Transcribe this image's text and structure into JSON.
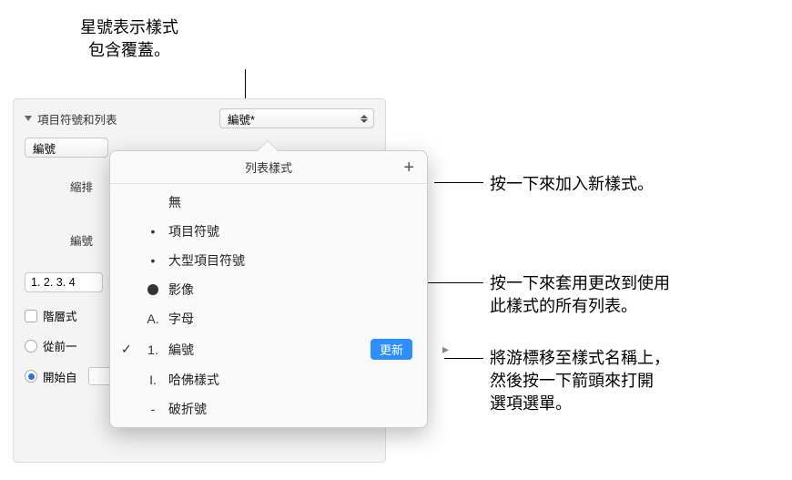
{
  "callouts": {
    "asterisk": "星號表示樣式\n包含覆蓋。",
    "add": "按一下來加入新樣式。",
    "update": "按一下來套用更改到使用\n此樣式的所有列表。",
    "arrow": "將游標移至樣式名稱上，\n然後按一下箭頭來打開\n選項選單。"
  },
  "panel": {
    "section_title": "項目符號和列表",
    "style_select_value": "編號*",
    "sub_select_value": "編號",
    "indent_label": "縮排",
    "numbering_label": "編號",
    "num_style_value": "1. 2. 3. 4",
    "hierarchical_label": "階層式",
    "continue_label": "從前一",
    "start_from_label": "開始自"
  },
  "popover": {
    "title": "列表樣式",
    "items": [
      {
        "bullet": "",
        "label": "無"
      },
      {
        "bullet": "•",
        "label": "項目符號"
      },
      {
        "bullet": "•",
        "label": "大型項目符號"
      },
      {
        "bullet": "IMG",
        "label": "影像"
      },
      {
        "bullet": "A.",
        "label": "字母"
      },
      {
        "bullet": "1.",
        "label": "編號",
        "selected": true,
        "update_label": "更新"
      },
      {
        "bullet": "I.",
        "label": "哈佛樣式"
      },
      {
        "bullet": "-",
        "label": "破折號"
      }
    ]
  }
}
